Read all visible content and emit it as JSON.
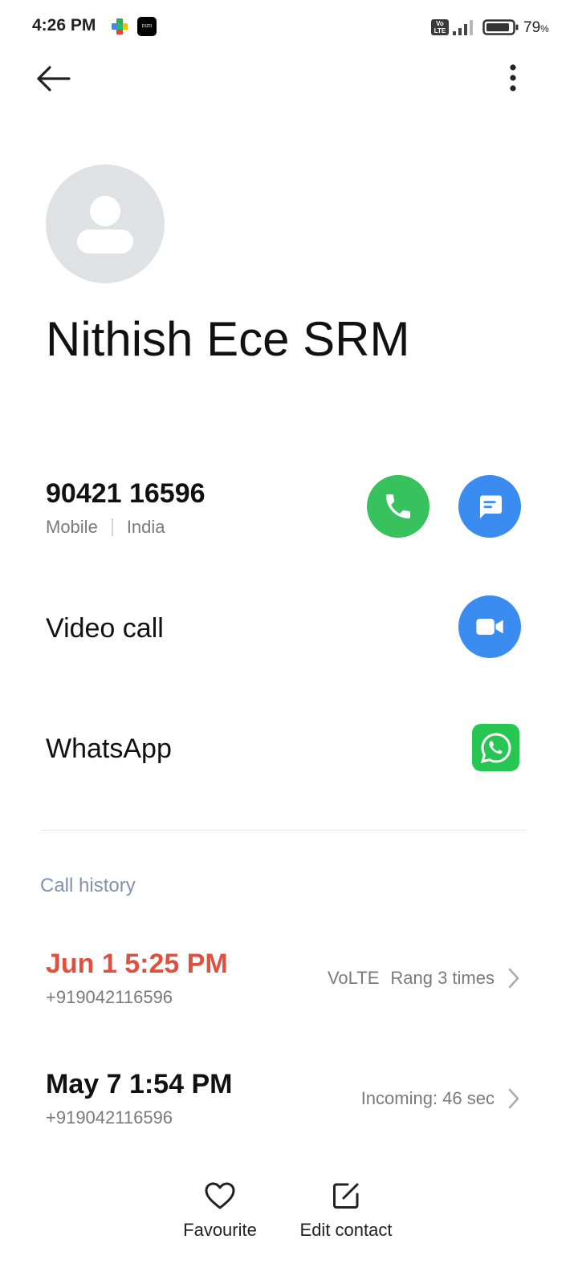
{
  "status_bar": {
    "time": "4:26 PM",
    "notification_icons": [
      "play-games-icon",
      "dizo-icon"
    ],
    "dizo_text": "DIZO",
    "volte_top": "Vo",
    "volte_bottom": "LTE",
    "battery_percent": "79",
    "battery_unit": "%"
  },
  "top_bar": {
    "back_icon": "back-arrow-icon",
    "more_icon": "more-vertical-icon"
  },
  "contact": {
    "name": "Nithish Ece SRM",
    "avatar_icon": "person-placeholder-icon"
  },
  "phone": {
    "number": "90421 16596",
    "type": "Mobile",
    "location": "India",
    "call_icon": "phone-icon",
    "message_icon": "message-icon"
  },
  "video_call": {
    "label": "Video call",
    "icon": "video-camera-icon"
  },
  "whatsapp": {
    "label": "WhatsApp",
    "icon": "whatsapp-icon"
  },
  "call_history": {
    "title": "Call history",
    "entries": [
      {
        "date": "Jun 1 5:25 PM",
        "number": "+919042116596",
        "network": "VoLTE",
        "status": "Rang 3 times",
        "missed": true
      },
      {
        "date": "May 7 1:54 PM",
        "number": "+919042116596",
        "network": "",
        "status": "Incoming: 46 sec",
        "missed": false
      }
    ]
  },
  "bottom_actions": {
    "favourite": "Favourite",
    "edit_contact": "Edit contact"
  },
  "colors": {
    "call_green": "#37c25e",
    "action_blue": "#3b8cf0",
    "whatsapp_green": "#27c653",
    "missed_red": "#e0503c",
    "section_title": "#8590b0",
    "avatar_bg": "#dfe1e5"
  }
}
